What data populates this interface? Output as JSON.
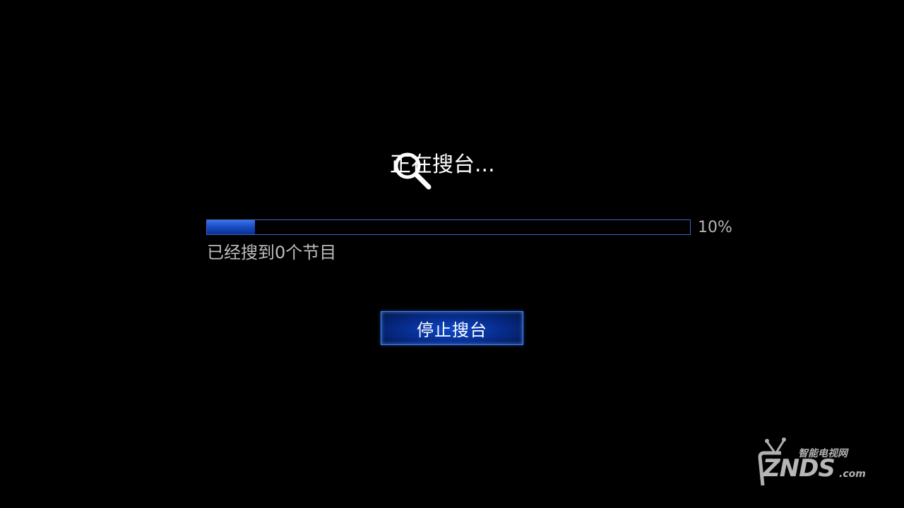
{
  "scan": {
    "title": "正在搜台...",
    "progress_percent": 10,
    "progress_label": "10%",
    "found_status": "已经搜到0个节目",
    "stop_label": "停止搜台"
  },
  "icons": {
    "search": "search-icon"
  },
  "colors": {
    "background": "#000000",
    "accent": "#1a4fc7",
    "button_border": "#3d86ff",
    "status_text": "#bdbdbd"
  },
  "watermark": {
    "cn": "智能电视网",
    "brand": "ZNDS",
    "domain": ".com"
  }
}
